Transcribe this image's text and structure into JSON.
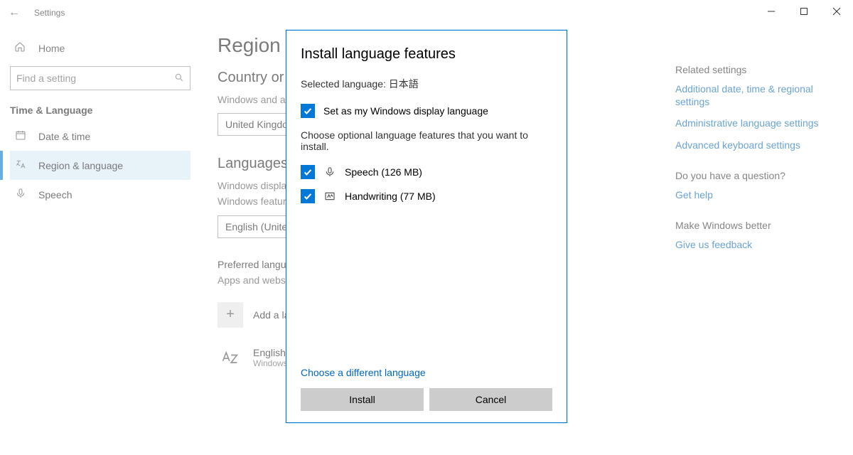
{
  "window": {
    "title": "Settings",
    "controls": {
      "minimize": "–",
      "maximize": "❐",
      "close": "✕"
    }
  },
  "sidebar": {
    "home": "Home",
    "search_placeholder": "Find a setting",
    "section": "Time & Language",
    "items": [
      {
        "icon": "calendar-icon",
        "label": "Date & time"
      },
      {
        "icon": "globe-az-icon",
        "label": "Region & language"
      },
      {
        "icon": "microphone-icon",
        "label": "Speech"
      }
    ],
    "active_index": 1
  },
  "main": {
    "page_title": "Region & language",
    "country_heading": "Country or region",
    "country_desc": "Windows and apps might use your country or region to give you local content",
    "country_value": "United Kingdom",
    "languages_heading": "Languages",
    "display_lang_label": "Windows display language",
    "display_lang_desc": "Windows features like Settings and File Explorer will appear in this language.",
    "display_lang_value": "English (United States)",
    "preferred_heading": "Preferred languages",
    "preferred_desc": "Apps and websites will appear in the first language in the list that they support.",
    "add_language": "Add a language",
    "lang1_name": "English (United States)",
    "lang1_sub": "Windows display language"
  },
  "related": {
    "title": "Related settings",
    "links": [
      "Additional date, time & regional settings",
      "Administrative language settings",
      "Advanced keyboard settings"
    ],
    "question": "Do you have a question?",
    "get_help": "Get help",
    "better": "Make Windows better",
    "feedback": "Give us feedback"
  },
  "dialog": {
    "title": "Install language features",
    "selected_label": "Selected language:",
    "selected_value": "日本語",
    "set_display": {
      "checked": true,
      "label": "Set as my Windows display language"
    },
    "choose_hint": "Choose optional language features that you want to install.",
    "features": [
      {
        "checked": true,
        "icon": "microphone-icon",
        "label": "Speech (126 MB)"
      },
      {
        "checked": true,
        "icon": "handwriting-icon",
        "label": "Handwriting (77 MB)"
      }
    ],
    "different_link": "Choose a different language",
    "install": "Install",
    "cancel": "Cancel"
  }
}
